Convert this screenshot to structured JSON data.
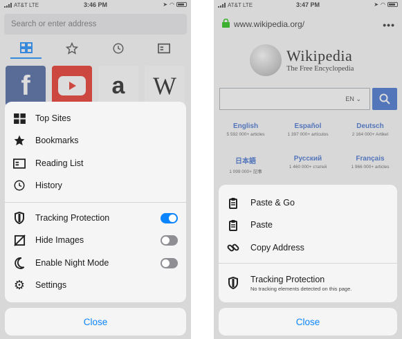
{
  "left_phone": {
    "status": {
      "carrier": "AT&T",
      "network": "LTE",
      "time": "3:46 PM"
    },
    "url_bar": {
      "placeholder": "Search or enter address"
    },
    "top_tabs": [
      {
        "icon": "grid-icon",
        "active": true
      },
      {
        "icon": "star-icon",
        "active": false
      },
      {
        "icon": "clock-icon",
        "active": false
      },
      {
        "icon": "reading-list-icon",
        "active": false
      }
    ],
    "top_sites": [
      {
        "name": "facebook",
        "glyph": "f",
        "color": "#3b5998"
      },
      {
        "name": "youtube",
        "color": "#e62117"
      },
      {
        "name": "amazon",
        "glyph": "a",
        "color": "#ffffff"
      },
      {
        "name": "wikipedia",
        "glyph": "W",
        "color": "#ffffff"
      }
    ],
    "menu": {
      "items": [
        {
          "label": "Top Sites",
          "icon": "grid-icon"
        },
        {
          "label": "Bookmarks",
          "icon": "star-icon"
        },
        {
          "label": "Reading List",
          "icon": "reading-list-icon"
        },
        {
          "label": "History",
          "icon": "clock-icon"
        }
      ],
      "toggles": [
        {
          "label": "Tracking Protection",
          "icon": "shield-icon",
          "on": true
        },
        {
          "label": "Hide Images",
          "icon": "hide-images-icon",
          "on": false
        },
        {
          "label": "Enable Night Mode",
          "icon": "moon-icon",
          "on": false
        }
      ],
      "settings_label": "Settings"
    },
    "close_label": "Close"
  },
  "right_phone": {
    "status": {
      "carrier": "AT&T",
      "network": "LTE",
      "time": "3:47 PM"
    },
    "url": "www.wikipedia.org/",
    "wikipedia": {
      "name": "Wikipedia",
      "tagline": "The Free Encyclopedia",
      "search_lang": "EN",
      "languages": [
        {
          "name": "English",
          "count": "5 592 000+ articles"
        },
        {
          "name": "Español",
          "count": "1 397 000+ artículos"
        },
        {
          "name": "Deutsch",
          "count": "2 164 000+ Artikel"
        },
        {
          "name": "日本語",
          "count": "1 099 000+ 記事"
        },
        {
          "name": "Русский",
          "count": "1 460 000+ статей"
        },
        {
          "name": "Français",
          "count": "1 966 000+ articles"
        }
      ]
    },
    "menu": {
      "items": [
        {
          "label": "Paste & Go",
          "icon": "clipboard-icon"
        },
        {
          "label": "Paste",
          "icon": "clipboard-icon"
        },
        {
          "label": "Copy Address",
          "icon": "link-icon"
        }
      ],
      "tracking_protection": {
        "title": "Tracking Protection",
        "subtitle": "No tracking elements detected on this page."
      }
    },
    "close_label": "Close"
  },
  "colors": {
    "accent": "#0a84ff",
    "wiki_blue": "#3366cc"
  }
}
